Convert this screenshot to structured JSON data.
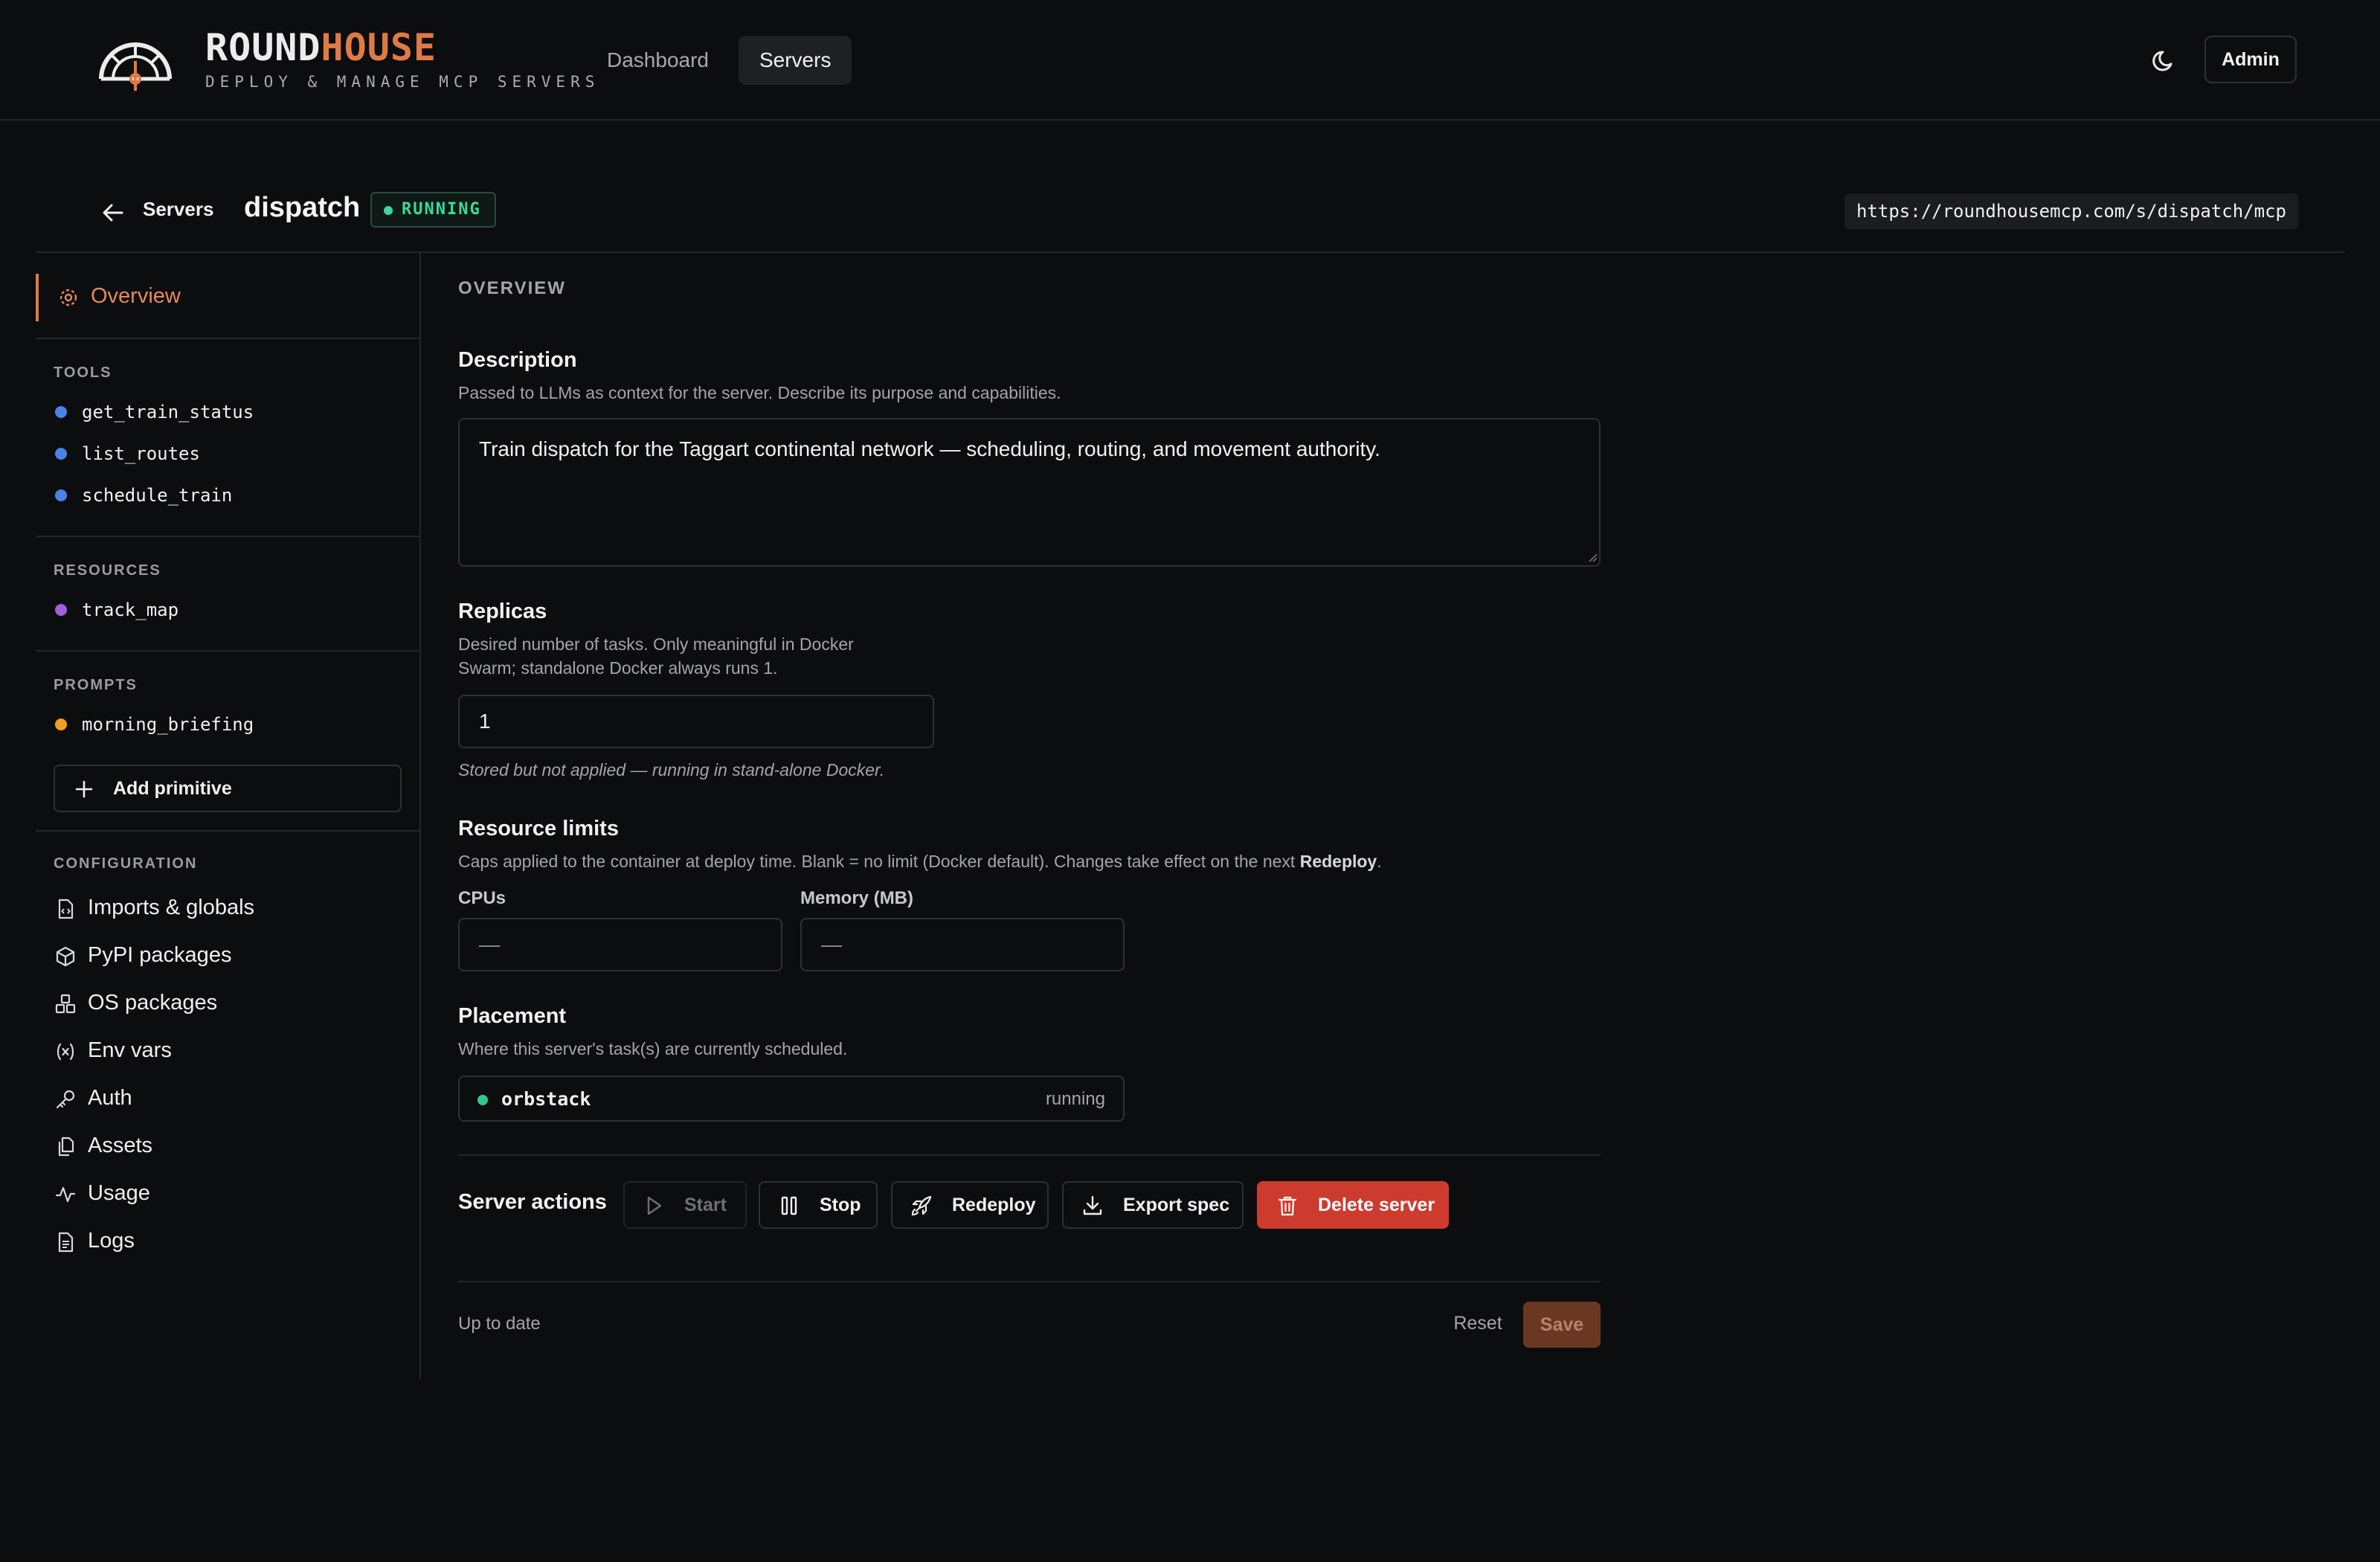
{
  "header": {
    "brand_part1": "ROUND",
    "brand_part2": "HOUSE",
    "tagline": "DEPLOY & MANAGE MCP SERVERS",
    "nav": [
      {
        "label": "Dashboard",
        "active": false
      },
      {
        "label": "Servers",
        "active": true
      }
    ],
    "theme_icon": "moon-icon",
    "admin_label": "Admin",
    "accent_color": "#df7a47"
  },
  "server": {
    "breadcrumb": "Servers",
    "name": "dispatch",
    "status": "RUNNING",
    "status_color": "#3fd79b",
    "endpoint": "https://roundhousemcp.com/s/dispatch/mcp"
  },
  "sidebar": {
    "overview_label": "Overview",
    "tools_heading": "TOOLS",
    "tools": [
      "get_train_status",
      "list_routes",
      "schedule_train"
    ],
    "resources_heading": "RESOURCES",
    "resources": [
      "track_map"
    ],
    "prompts_heading": "PROMPTS",
    "prompts": [
      "morning_briefing"
    ],
    "add_primitive_label": "Add primitive",
    "configuration_heading": "CONFIGURATION",
    "config_items": [
      {
        "label": "Imports & globals",
        "icon": "file-code-icon"
      },
      {
        "label": "PyPI packages",
        "icon": "package-icon"
      },
      {
        "label": "OS packages",
        "icon": "boxes-icon"
      },
      {
        "label": "Env vars",
        "icon": "variable-icon"
      },
      {
        "label": "Auth",
        "icon": "key-icon"
      },
      {
        "label": "Assets",
        "icon": "files-icon"
      },
      {
        "label": "Usage",
        "icon": "activity-icon"
      },
      {
        "label": "Logs",
        "icon": "file-text-icon"
      }
    ],
    "dot_colors": {
      "tool": "#4a82e8",
      "resource": "#a45ee0",
      "prompt": "#f0a020"
    }
  },
  "overview": {
    "section_label": "OVERVIEW",
    "description": {
      "title": "Description",
      "help": "Passed to LLMs as context for the server. Describe its purpose and capabilities.",
      "value": "Train dispatch for the Taggart continental network — scheduling, routing, and movement authority."
    },
    "replicas": {
      "title": "Replicas",
      "help_line1": "Desired number of tasks. Only meaningful in Docker",
      "help_line2": "Swarm; standalone Docker always runs 1.",
      "value": "1",
      "note": "Stored but not applied — running in stand-alone Docker."
    },
    "resource_limits": {
      "title": "Resource limits",
      "help_prefix": "Caps applied to the container at deploy time. Blank = no limit (Docker default). Changes take effect on the next ",
      "help_bold": "Redeploy",
      "help_suffix": ".",
      "cpus_label": "CPUs",
      "cpus_placeholder": "—",
      "memory_label": "Memory (MB)",
      "memory_placeholder": "—"
    },
    "placement": {
      "title": "Placement",
      "help": "Where this server's task(s) are currently scheduled.",
      "node": "orbstack",
      "state": "running"
    },
    "actions": {
      "title": "Server actions",
      "start": "Start",
      "stop": "Stop",
      "redeploy": "Redeploy",
      "export": "Export spec",
      "delete": "Delete server",
      "danger_color": "#cd3b2f"
    },
    "footer": {
      "status": "Up to date",
      "reset": "Reset",
      "save": "Save"
    }
  }
}
